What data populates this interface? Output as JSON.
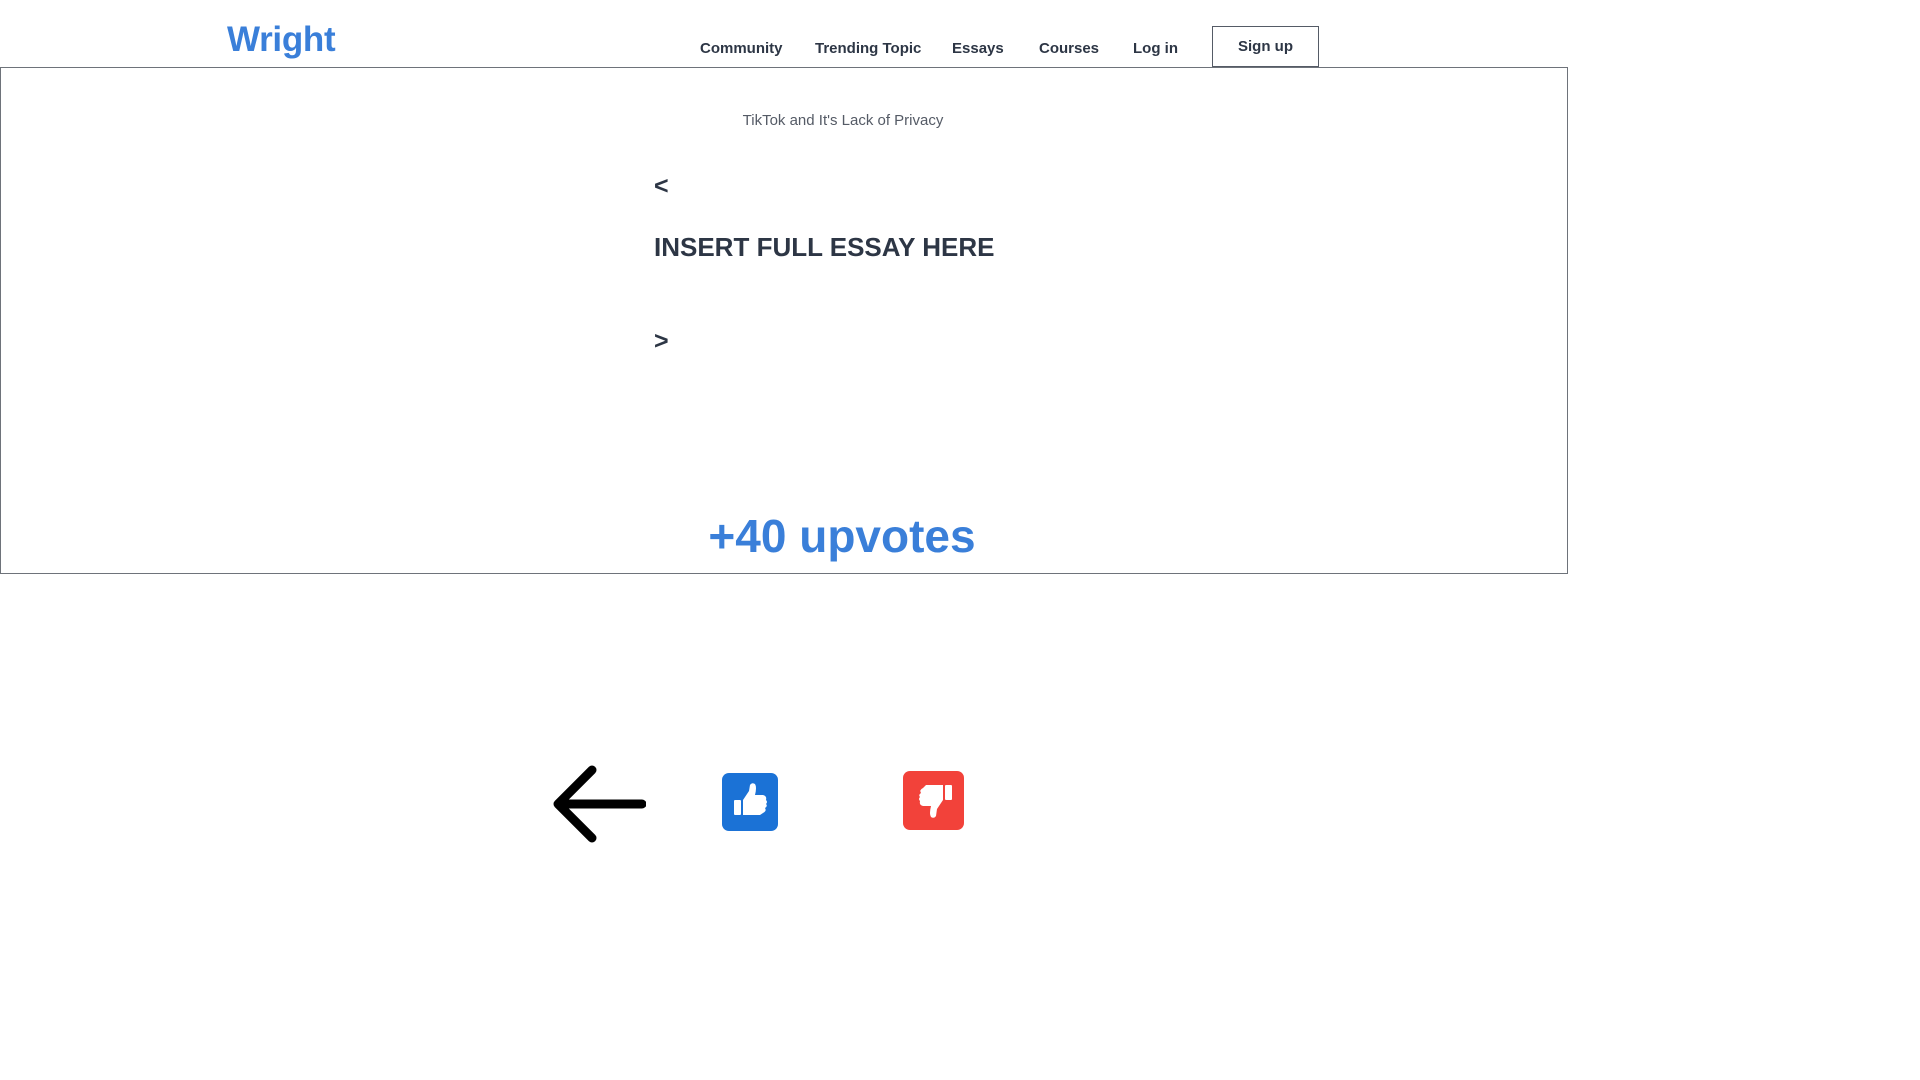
{
  "brand": {
    "name": "Wright",
    "color": "#3a7fd9"
  },
  "nav": {
    "items": [
      {
        "label": "Community"
      },
      {
        "label": "Trending Topic"
      },
      {
        "label": "Essays"
      },
      {
        "label": "Courses"
      },
      {
        "label": "Log in"
      }
    ],
    "signup_label": "Sign up"
  },
  "essay": {
    "title": "TikTok and It's Lack of Privacy",
    "prev_label": "<",
    "body": "INSERT FULL ESSAY HERE",
    "next_label": ">",
    "upvotes": "+40 upvotes"
  },
  "actions": {
    "back_icon": "arrow-left-icon",
    "like_icon": "thumbs-up-icon",
    "like_color": "#1b72d6",
    "dislike_icon": "thumbs-down-icon",
    "dislike_color": "#f2423a"
  }
}
